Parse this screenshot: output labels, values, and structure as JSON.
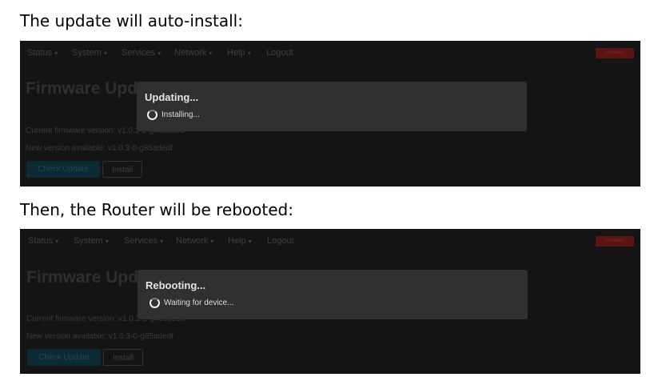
{
  "captions": {
    "first": "The update will auto-install:",
    "second": "Then, the Router will be rebooted:"
  },
  "router_ui": {
    "nav": [
      "Status",
      "System",
      "Services",
      "Network",
      "Help",
      "Logout"
    ],
    "nav_caret": "▾",
    "badge": "unsaved",
    "page_title": "Firmware Update",
    "current_firmware": "Current firmware version: v1.0.2-2-g40bc05d",
    "new_version": "New version available: v1.0.3-0-g85adedf",
    "check_button": "Check Update",
    "install_button": "Install"
  },
  "dialogs": [
    {
      "title": "Updating...",
      "message": "Installing..."
    },
    {
      "title": "Rebooting...",
      "message": "Waiting for device..."
    }
  ],
  "colors": {
    "background": "#141414",
    "modal": "#303030",
    "badge": "#5a1414"
  }
}
